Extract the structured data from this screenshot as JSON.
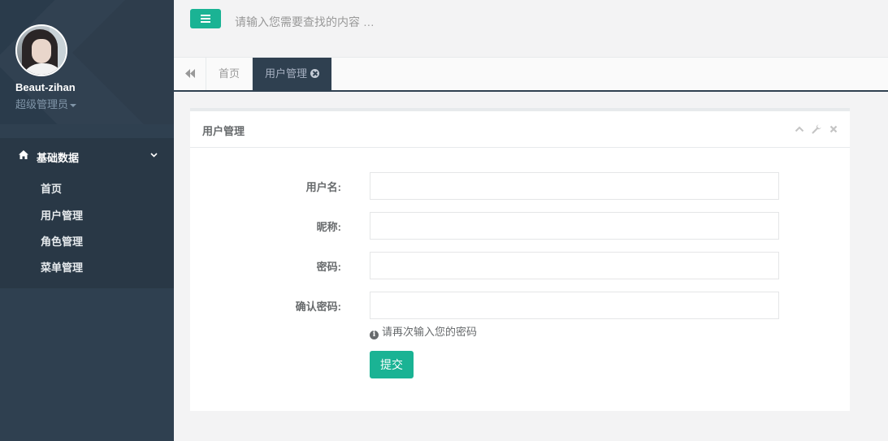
{
  "profile": {
    "name": "Beaut-zihan",
    "role": "超级管理员"
  },
  "sidebar": {
    "group_label": "基础数据",
    "items": [
      {
        "label": "首页"
      },
      {
        "label": "用户管理"
      },
      {
        "label": "角色管理"
      },
      {
        "label": "菜单管理"
      }
    ]
  },
  "topbar": {
    "search_placeholder": "请输入您需要查找的内容 …"
  },
  "tabs": [
    {
      "label": "首页",
      "active": false
    },
    {
      "label": "用户管理",
      "active": true
    }
  ],
  "panel": {
    "title": "用户管理",
    "fields": [
      {
        "label": "用户名:",
        "value": ""
      },
      {
        "label": "昵称:",
        "value": ""
      },
      {
        "label": "密码:",
        "value": ""
      },
      {
        "label": "确认密码:",
        "value": ""
      }
    ],
    "help_text": "请再次输入您的密码",
    "submit_label": "提交"
  },
  "colors": {
    "sidebar": "#2f4050",
    "accent": "#1ab394",
    "text": "#676a6c"
  },
  "icons": [
    "menu-icon",
    "home-icon",
    "chevron-down-icon",
    "double-left-icon",
    "close-icon",
    "chevron-up-icon",
    "wrench-icon",
    "info-icon"
  ]
}
